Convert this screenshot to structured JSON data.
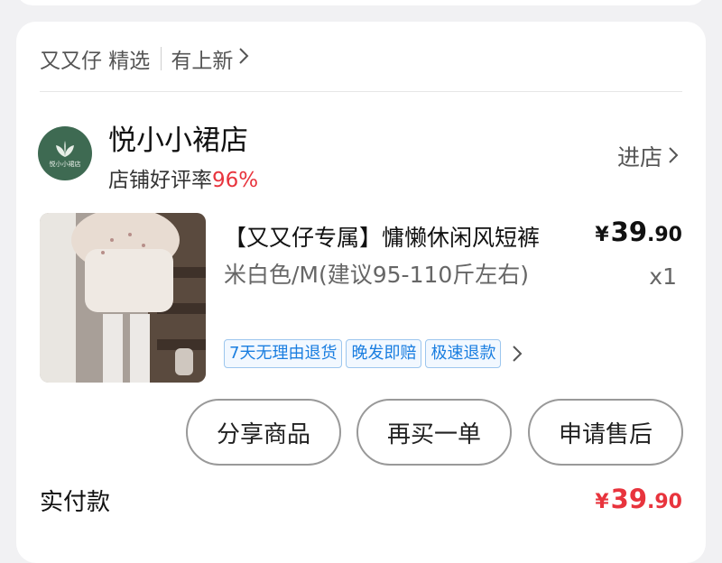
{
  "promo": {
    "brand_label": "又又仔 精选",
    "new_label": "有上新"
  },
  "shop": {
    "name": "悦小小裙店",
    "rating_label": "店铺好评率",
    "rating_value": "96%",
    "enter_label": "进店",
    "logo_text": "悦小小裙店"
  },
  "product": {
    "title": "【又又仔专属】慵懒休闲风短裤",
    "price_currency": "¥",
    "price_int": "39",
    "price_dec": ".90",
    "variant": "米白色/M(建议95-110斤左右)",
    "quantity": "x1",
    "tags": [
      "7天无理由退货",
      "晚发即赔",
      "极速退款"
    ]
  },
  "actions": {
    "share": "分享商品",
    "rebuy": "再买一单",
    "after_sale": "申请售后"
  },
  "payment": {
    "label": "实付款",
    "currency": "¥",
    "int": "39",
    "dec": ".90"
  },
  "colors": {
    "accent_red": "#e8343d",
    "tag_blue": "#1a7ee0",
    "logo_green": "#3e6a52"
  }
}
